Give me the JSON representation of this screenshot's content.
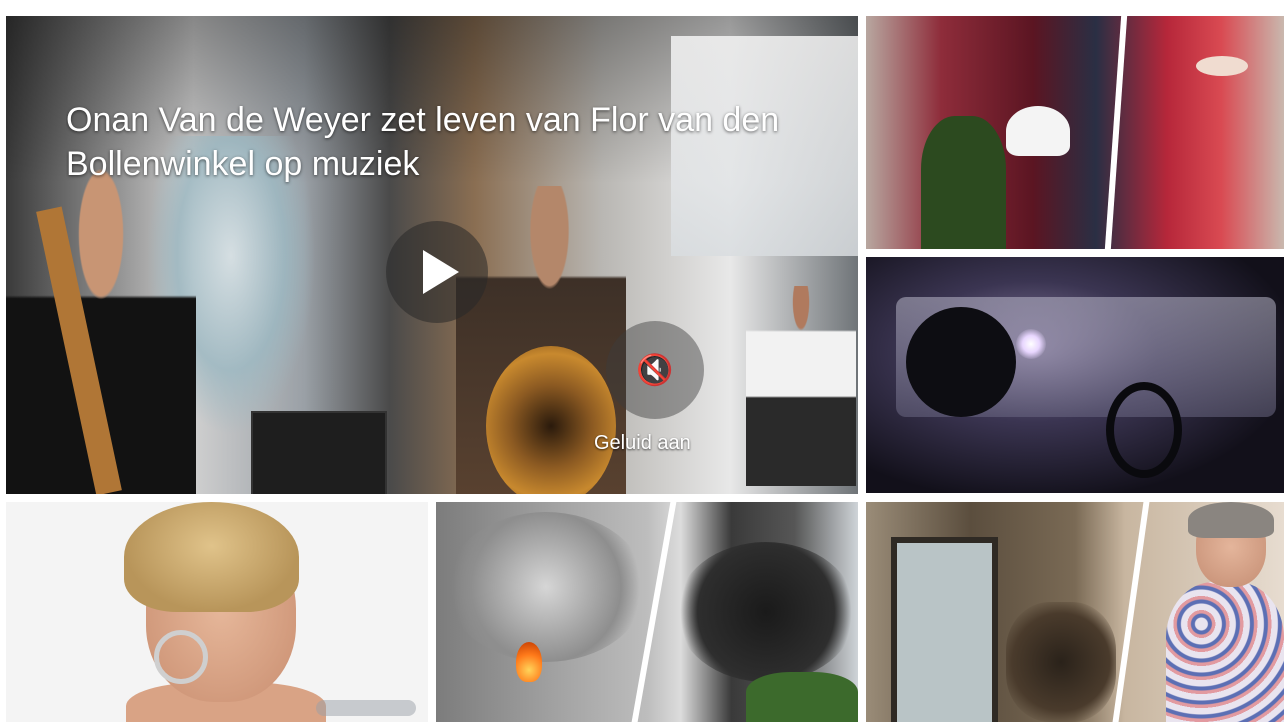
{
  "featured_video": {
    "title": "Onan Van de Weyer zet leven van Flor van den Bollenwinkel op muziek",
    "play_icon": "play-icon",
    "mute_icon": "speaker-muted-icon",
    "mute_glyph": "🔇",
    "sound_label": "Geluid aan"
  },
  "tiles": [
    {
      "name": "royals-parade",
      "icon": "photo"
    },
    {
      "name": "car-burglar",
      "icon": "photo"
    },
    {
      "name": "actress-portrait",
      "icon": "photo"
    },
    {
      "name": "industrial-fire",
      "icon": "photo"
    },
    {
      "name": "fire-damage-elderly-woman",
      "icon": "photo"
    }
  ]
}
